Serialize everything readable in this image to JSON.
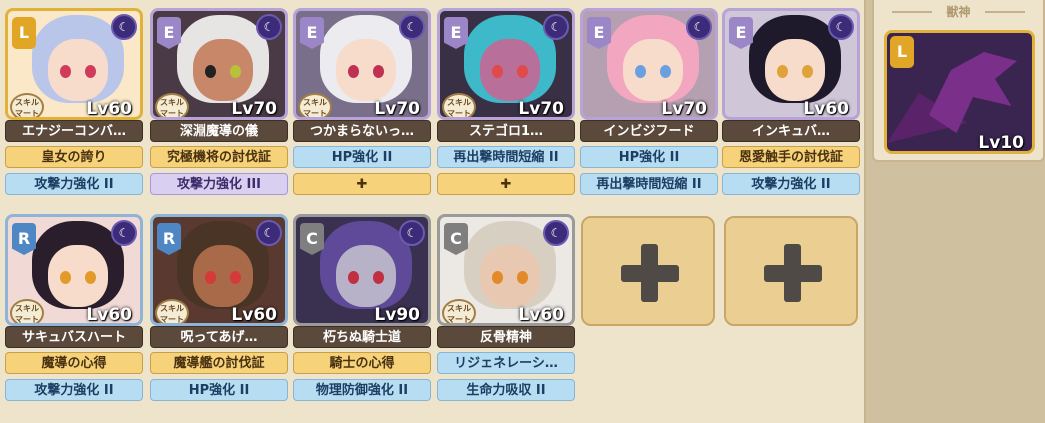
{
  "pet": {
    "title": "獣神",
    "level": "Lv10",
    "rank": "L"
  },
  "skill_mark_text": "スキル\nマート",
  "units": [
    {
      "rank": "L",
      "level": "Lv60",
      "name": "エナジーコンバ…",
      "skill1": "皇女の誇り",
      "skill2": "攻撃力強化 II",
      "colors": {
        "hair": "#b9c6ea",
        "eye": "#d13a5a"
      }
    },
    {
      "rank": "E",
      "level": "Lv70",
      "name": "深淵魔導の儀",
      "skill1": "究極機将の討伐証",
      "skill2": "攻撃力強化 III",
      "colors": {
        "hair": "#e7e4e4",
        "eye": "#b6c23a"
      }
    },
    {
      "rank": "E",
      "level": "Lv70",
      "name": "つかまらないっ…",
      "skill1": "HP強化 II",
      "skill2": "✚",
      "colors": {
        "hair": "#ecebef",
        "eye": "#c03050"
      }
    },
    {
      "rank": "E",
      "level": "Lv70",
      "name": "ステゴロ1…",
      "skill1": "再出撃時間短縮 II",
      "skill2": "✚",
      "colors": {
        "hair": "#3eb9c9",
        "eye": "#e04a4a"
      }
    },
    {
      "rank": "E",
      "level": "Lv70",
      "name": "インビジフード",
      "skill1": "HP強化 II",
      "skill2": "再出撃時間短縮 II",
      "colors": {
        "hair": "#f3a6c0",
        "eye": "#6aa0e0"
      }
    },
    {
      "rank": "E",
      "level": "Lv60",
      "name": "インキュバ…",
      "skill1": "恩愛触手の討伐証",
      "skill2": "攻撃力強化 II",
      "colors": {
        "hair": "#1e1a2c",
        "eye": "#e0a33a"
      }
    },
    {
      "rank": "R",
      "level": "Lv60",
      "name": "サキュバスハート",
      "skill1": "魔導の心得",
      "skill2": "攻撃力強化 II",
      "colors": {
        "hair": "#2a1d2c",
        "eye": "#e39a2a"
      }
    },
    {
      "rank": "R",
      "level": "Lv60",
      "name": "呪ってあげ…",
      "skill1": "魔導艦の討伐証",
      "skill2": "HP強化 II",
      "colors": {
        "hair": "#4a3426",
        "eye": "#d43a3a"
      }
    },
    {
      "rank": "C",
      "level": "Lv90",
      "name": "朽ちぬ騎士道",
      "skill1": "騎士の心得",
      "skill2": "物理防御強化 II",
      "colors": {
        "hair": "#5f4a9a",
        "eye": "#c03040"
      }
    },
    {
      "rank": "C",
      "level": "Lv60",
      "name": "反骨精神",
      "skill1": "リジェネレーシ…",
      "skill2": "生命力吸収 II",
      "colors": {
        "hair": "#d7d0c2",
        "eye": "#e28a2a"
      }
    }
  ],
  "add_label": "✚"
}
